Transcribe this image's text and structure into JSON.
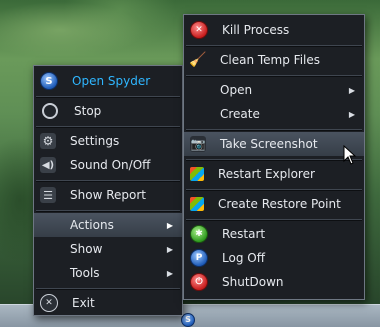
{
  "colors": {
    "menu_bg": "#1c1f24",
    "menu_border": "#6e7783",
    "highlight": "#4a5360",
    "accent_text": "#2fb6ff",
    "text": "#e6e9ee"
  },
  "left_menu": {
    "items": [
      {
        "label": "Open Spyder",
        "icon": "spyder-logo-icon"
      },
      {
        "label": "Stop",
        "icon": "stop-icon"
      },
      {
        "label": "Settings",
        "icon": "gear-icon"
      },
      {
        "label": "Sound On/Off",
        "icon": "speaker-icon"
      },
      {
        "label": "Show Report",
        "icon": "list-icon"
      },
      {
        "label": "Actions",
        "icon": "",
        "submenu": true
      },
      {
        "label": "Show",
        "icon": "",
        "submenu": true
      },
      {
        "label": "Tools",
        "icon": "",
        "submenu": true
      },
      {
        "label": "Exit",
        "icon": "exit-icon"
      }
    ]
  },
  "right_menu": {
    "items": [
      {
        "label": "Kill Process",
        "icon": "kill-process-icon"
      },
      {
        "label": "Clean Temp Files",
        "icon": "broom-icon"
      },
      {
        "label": "Open",
        "icon": "",
        "submenu": true
      },
      {
        "label": "Create",
        "icon": "",
        "submenu": true
      },
      {
        "label": "Take Screenshot",
        "icon": "camera-icon"
      },
      {
        "label": "Restart Explorer",
        "icon": "explorer-icon"
      },
      {
        "label": "Create Restore Point",
        "icon": "restore-point-icon"
      },
      {
        "label": "Restart",
        "icon": "restart-icon"
      },
      {
        "label": "Log Off",
        "icon": "log-off-icon"
      },
      {
        "label": "ShutDown",
        "icon": "shutdown-icon"
      }
    ]
  },
  "tray": {
    "icon": "spyder-tray-icon"
  }
}
